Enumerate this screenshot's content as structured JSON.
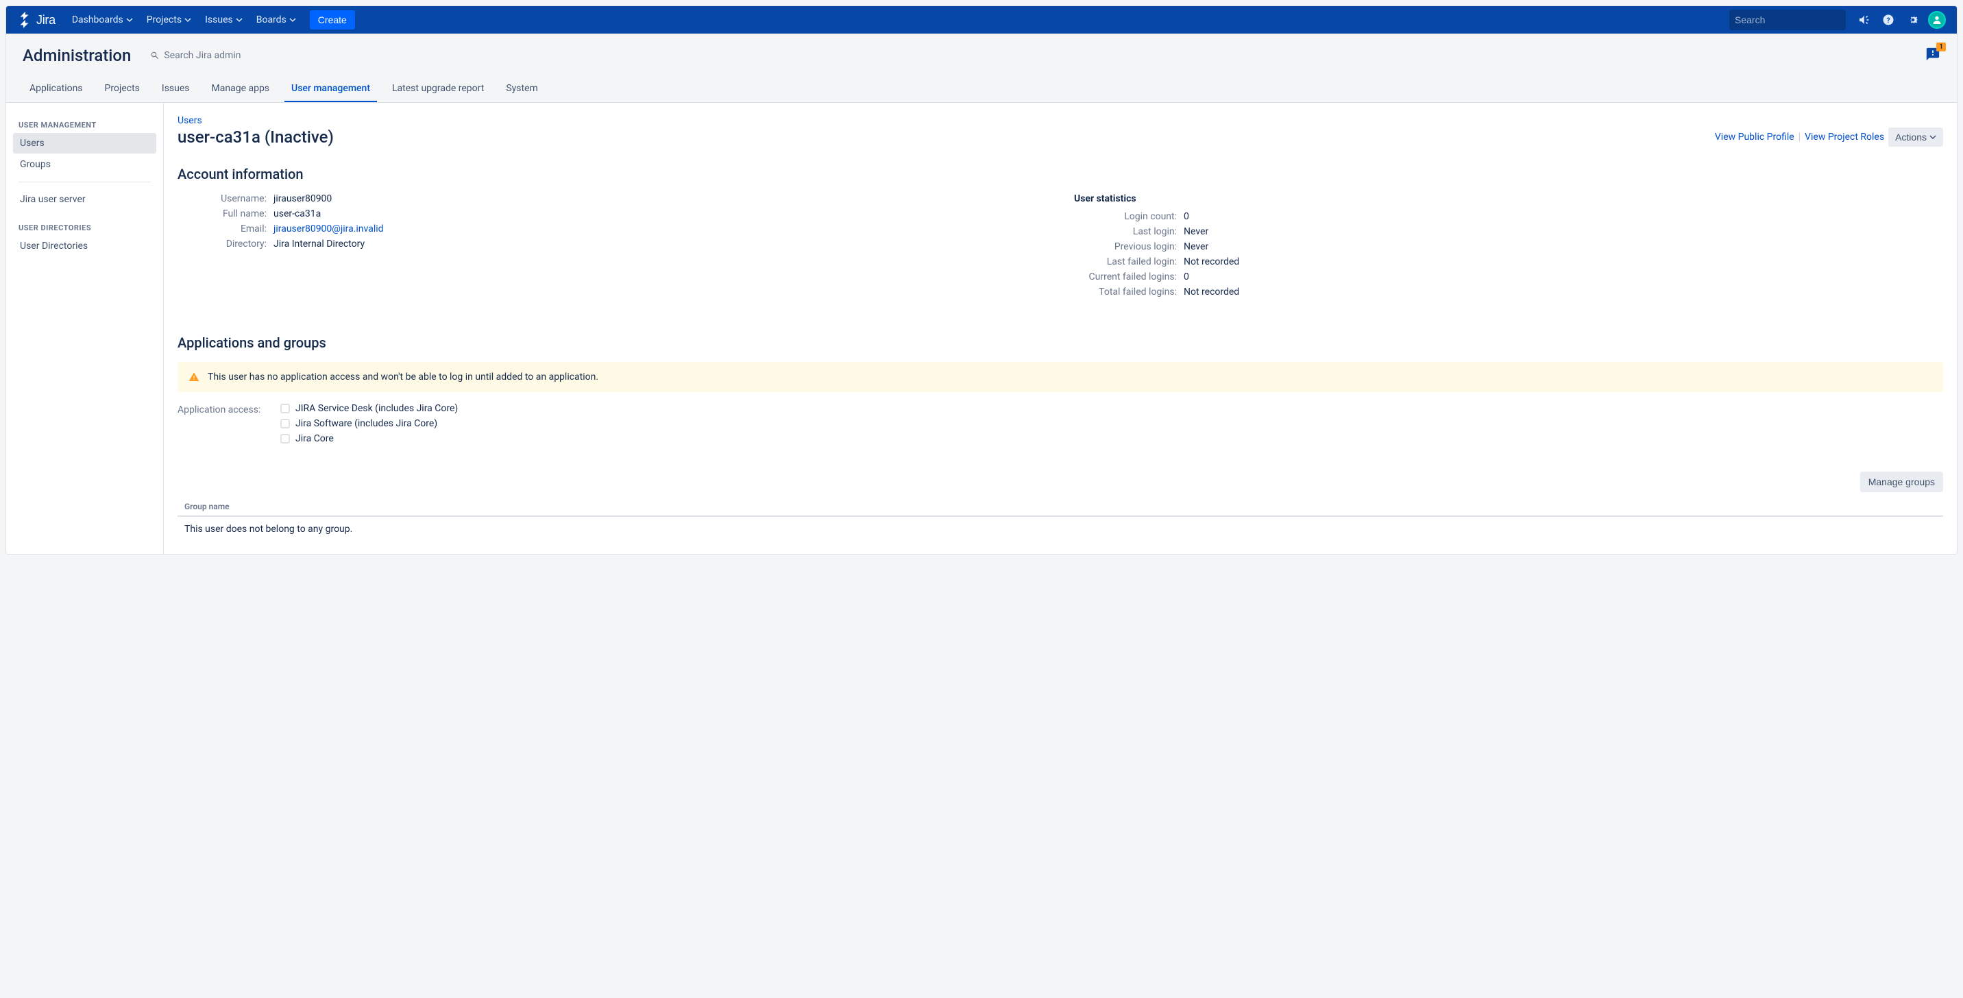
{
  "topNav": {
    "logoText": "Jira",
    "items": [
      "Dashboards",
      "Projects",
      "Issues",
      "Boards"
    ],
    "createLabel": "Create",
    "searchPlaceholder": "Search"
  },
  "adminHeader": {
    "title": "Administration",
    "searchPlaceholder": "Search Jira admin",
    "badgeCount": "1",
    "tabs": [
      "Applications",
      "Projects",
      "Issues",
      "Manage apps",
      "User management",
      "Latest upgrade report",
      "System"
    ],
    "activeTab": "User management"
  },
  "sidebar": {
    "heading1": "USER MANAGEMENT",
    "items1": [
      "Users",
      "Groups"
    ],
    "jiraUserServer": "Jira user server",
    "heading2": "USER DIRECTORIES",
    "items2": [
      "User Directories"
    ],
    "activeItem": "Users"
  },
  "breadcrumb": {
    "users": "Users"
  },
  "pageTitle": "user-ca31a (Inactive)",
  "pageActions": {
    "viewPublicProfile": "View Public Profile",
    "viewProjectRoles": "View Project Roles",
    "actions": "Actions"
  },
  "accountInfo": {
    "title": "Account information",
    "fields": {
      "usernameLabel": "Username:",
      "usernameValue": "jirauser80900",
      "fullNameLabel": "Full name:",
      "fullNameValue": "user-ca31a",
      "emailLabel": "Email:",
      "emailValue": "jirauser80900@jira.invalid",
      "directoryLabel": "Directory:",
      "directoryValue": "Jira Internal Directory"
    }
  },
  "userStats": {
    "title": "User statistics",
    "fields": {
      "loginCountLabel": "Login count:",
      "loginCountValue": "0",
      "lastLoginLabel": "Last login:",
      "lastLoginValue": "Never",
      "previousLoginLabel": "Previous login:",
      "previousLoginValue": "Never",
      "lastFailedLabel": "Last failed login:",
      "lastFailedValue": "Not recorded",
      "currentFailedLabel": "Current failed logins:",
      "currentFailedValue": "0",
      "totalFailedLabel": "Total failed logins:",
      "totalFailedValue": "Not recorded"
    }
  },
  "appsGroups": {
    "title": "Applications and groups",
    "warning": "This user has no application access and won't be able to log in until added to an application.",
    "appAccessLabel": "Application access:",
    "apps": [
      "JIRA Service Desk (includes Jira Core)",
      "Jira Software (includes Jira Core)",
      "Jira Core"
    ],
    "manageGroupsLabel": "Manage groups",
    "groupNameHeader": "Group name",
    "emptyGroupsText": "This user does not belong to any group."
  }
}
